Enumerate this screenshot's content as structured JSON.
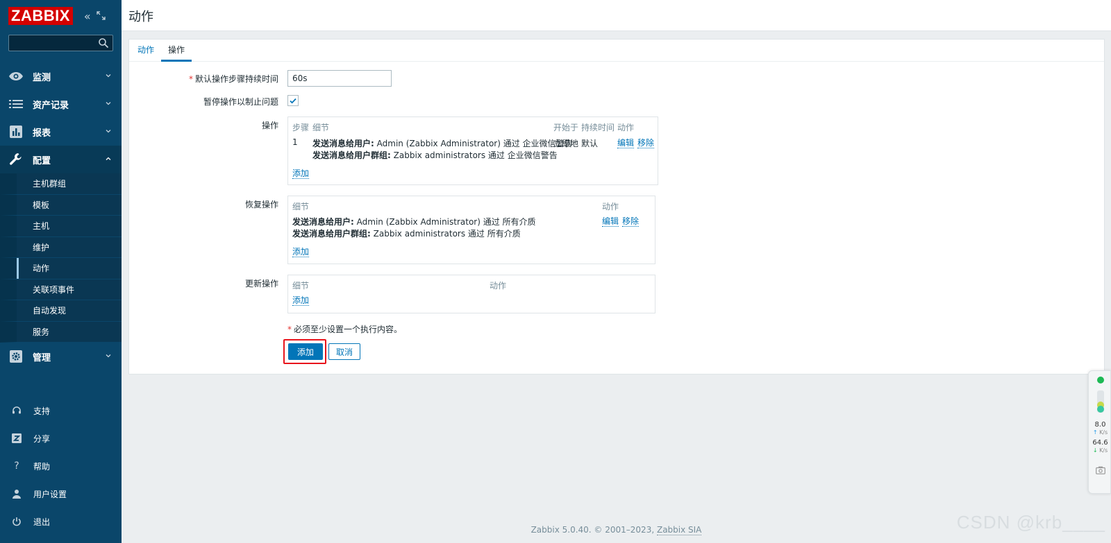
{
  "app": {
    "logo_text": "ZABBIX",
    "brand_color": "#d40000",
    "sidebar_color": "#0a466a",
    "accent_color": "#0275b8"
  },
  "sidebar": {
    "search_placeholder": "",
    "nav": [
      {
        "label": "监测",
        "icon": "eye-icon"
      },
      {
        "label": "资产记录",
        "icon": "list-icon"
      },
      {
        "label": "报表",
        "icon": "bar-chart-icon"
      },
      {
        "label": "配置",
        "icon": "wrench-icon"
      },
      {
        "label": "管理",
        "icon": "gear-icon"
      }
    ],
    "config_sub": [
      {
        "label": "主机群组"
      },
      {
        "label": "模板"
      },
      {
        "label": "主机"
      },
      {
        "label": "维护"
      },
      {
        "label": "动作"
      },
      {
        "label": "关联项事件"
      },
      {
        "label": "自动发现"
      },
      {
        "label": "服务"
      }
    ],
    "bottom": [
      {
        "label": "支持",
        "icon": "headset-icon"
      },
      {
        "label": "分享",
        "icon": "share-icon"
      },
      {
        "label": "帮助",
        "icon": "help-icon"
      },
      {
        "label": "用户设置",
        "icon": "user-icon"
      },
      {
        "label": "退出",
        "icon": "power-icon"
      }
    ]
  },
  "header": {
    "title": "动作"
  },
  "tabs": [
    {
      "label": "动作"
    },
    {
      "label": "操作"
    }
  ],
  "form": {
    "duration_label": "默认操作步骤持续时间",
    "duration_value": "60s",
    "pause_label": "暂停操作以制止问题",
    "pause_checked": true,
    "ops": {
      "label": "操作",
      "headers": {
        "step": "步骤",
        "details": "细节",
        "start": "开始于",
        "duration": "持续时间",
        "action": "动作"
      },
      "row": {
        "step": "1",
        "line1_bold": "发送消息给用户:",
        "line1_text": "Admin (Zabbix Administrator) 通过 企业微信警告",
        "line2_bold": "发送消息给用户群组:",
        "line2_text": "Zabbix administrators 通过 企业微信警告",
        "start": "立即地",
        "duration": "默认",
        "edit": "编辑",
        "remove": "移除"
      },
      "add": "添加"
    },
    "recovery": {
      "label": "恢复操作",
      "headers": {
        "details": "细节",
        "action": "动作"
      },
      "row": {
        "line1_bold": "发送消息给用户:",
        "line1_text": "Admin (Zabbix Administrator) 通过 所有介质",
        "line2_bold": "发送消息给用户群组:",
        "line2_text": "Zabbix administrators 通过 所有介质",
        "edit": "编辑",
        "remove": "移除"
      },
      "add": "添加"
    },
    "update": {
      "label": "更新操作",
      "headers": {
        "details": "细节",
        "action": "动作"
      },
      "add": "添加"
    },
    "note": "必须至少设置一个执行内容。",
    "submit": "添加",
    "cancel": "取消"
  },
  "footer": {
    "text": "Zabbix 5.0.40. © 2001–2023,",
    "link": "Zabbix SIA"
  },
  "watermark": "CSDN @krb____",
  "widget": {
    "up_value": "8.0",
    "up_unit": "K/s",
    "down_value": "64.6",
    "down_unit": "K/s"
  }
}
